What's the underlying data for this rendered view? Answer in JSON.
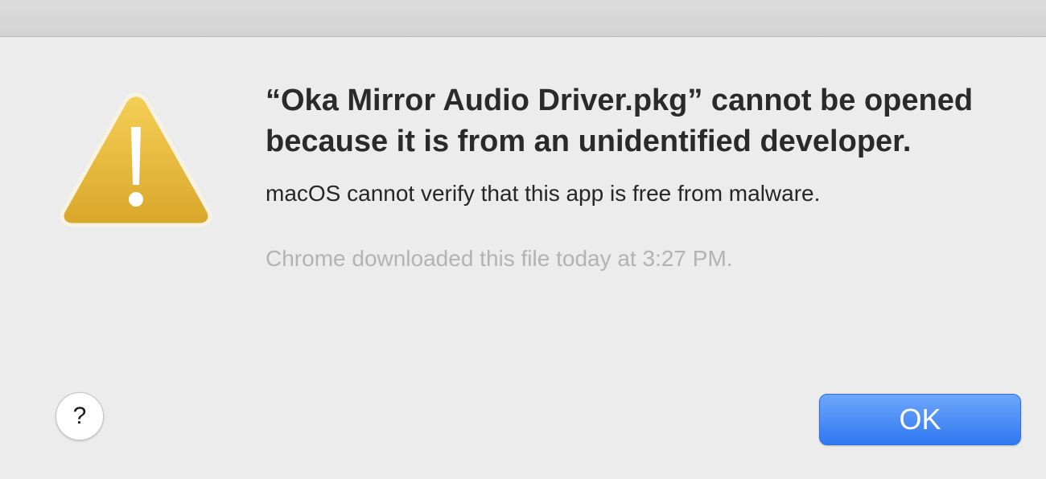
{
  "dialog": {
    "heading": "“Oka Mirror Audio Driver.pkg” cannot be opened because it is from an unidentified developer.",
    "message": "macOS cannot verify that this app is free from malware.",
    "source_note": "Chrome downloaded this file today at 3:27 PM.",
    "icon": "warning-triangle-icon",
    "accent_color": "#3a7ff2"
  },
  "buttons": {
    "help_label": "?",
    "ok_label": "OK"
  }
}
